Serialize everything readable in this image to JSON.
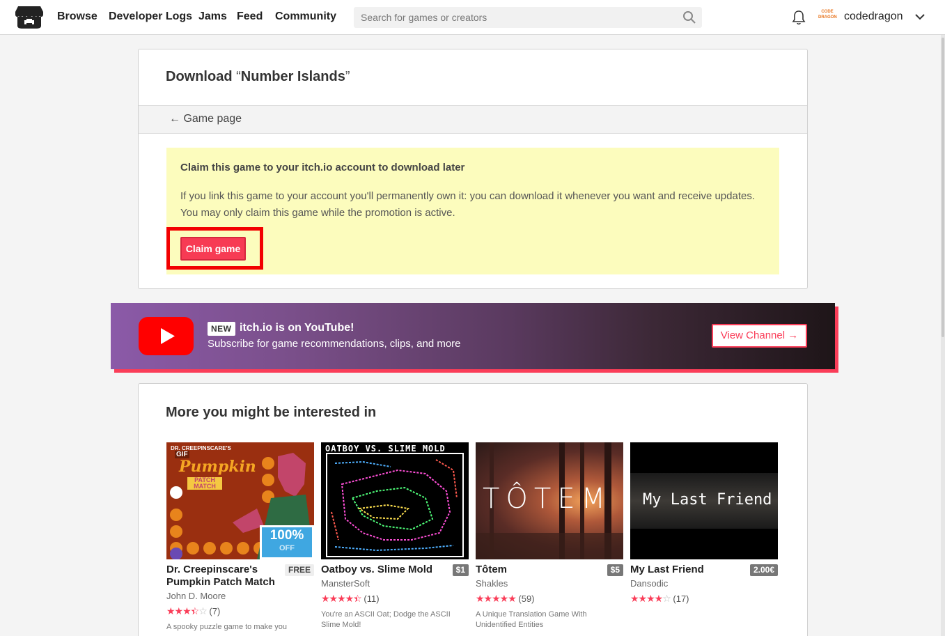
{
  "header": {
    "nav": [
      "Browse",
      "Developer Logs",
      "Jams",
      "Feed",
      "Community"
    ],
    "search_placeholder": "Search for games or creators",
    "avatar_text": "CODE DRAGON",
    "username": "codedragon"
  },
  "download": {
    "title_prefix": "Download ",
    "open_quote": "“",
    "game_name": "Number Islands",
    "close_quote": "”",
    "back_link": "← Game page",
    "claim_title": "Claim this game to your itch.io account to download later",
    "claim_desc": "If you link this game to your account you'll permanently own it: you can download it whenever you want and receive updates. You may only claim this game while the promotion is active.",
    "claim_button": "Claim game"
  },
  "youtube": {
    "badge": "NEW",
    "title": "itch.io is on YouTube!",
    "subtitle": "Subscribe for game recommendations, clips, and more",
    "button": "View Channel →"
  },
  "recommendations": {
    "title": "More you might be interested in",
    "games": [
      {
        "title": "Dr. Creepinscare's Pumpkin Patch Match",
        "price": "FREE",
        "author": "John D. Moore",
        "stars": 3.5,
        "count": "(7)",
        "desc": "A spooky puzzle game to make you",
        "thumb_text": "Pumpkin",
        "thumb_sub": "PATCH MATCH",
        "thumb_top": "DR. CREEPINSCARE'S",
        "gif": "GIF",
        "sale": "100%",
        "sale_sub": "OFF"
      },
      {
        "title": "Oatboy vs. Slime Mold",
        "price": "$1",
        "author": "MansterSoft",
        "stars": 4.5,
        "count": "(11)",
        "desc": "You're an ASCII Oat; Dodge the ASCII Slime Mold!",
        "thumb_text": "OATBOY VS. SLIME MOLD"
      },
      {
        "title": "Tôtem",
        "price": "$5",
        "author": "Shakles",
        "stars": 5,
        "count": "(59)",
        "desc": "A Unique Translation Game With Unidentified Entities",
        "thumb_text": "TÔTEM"
      },
      {
        "title": "My Last Friend",
        "price": "2.00€",
        "author": "Dansodic",
        "stars": 4,
        "count": "(17)",
        "desc": "",
        "thumb_text": "My Last Friend"
      }
    ]
  },
  "colors": {
    "accent": "#fa3d58",
    "claim_bg": "#fcfcbd",
    "highlight": "#f20000"
  }
}
